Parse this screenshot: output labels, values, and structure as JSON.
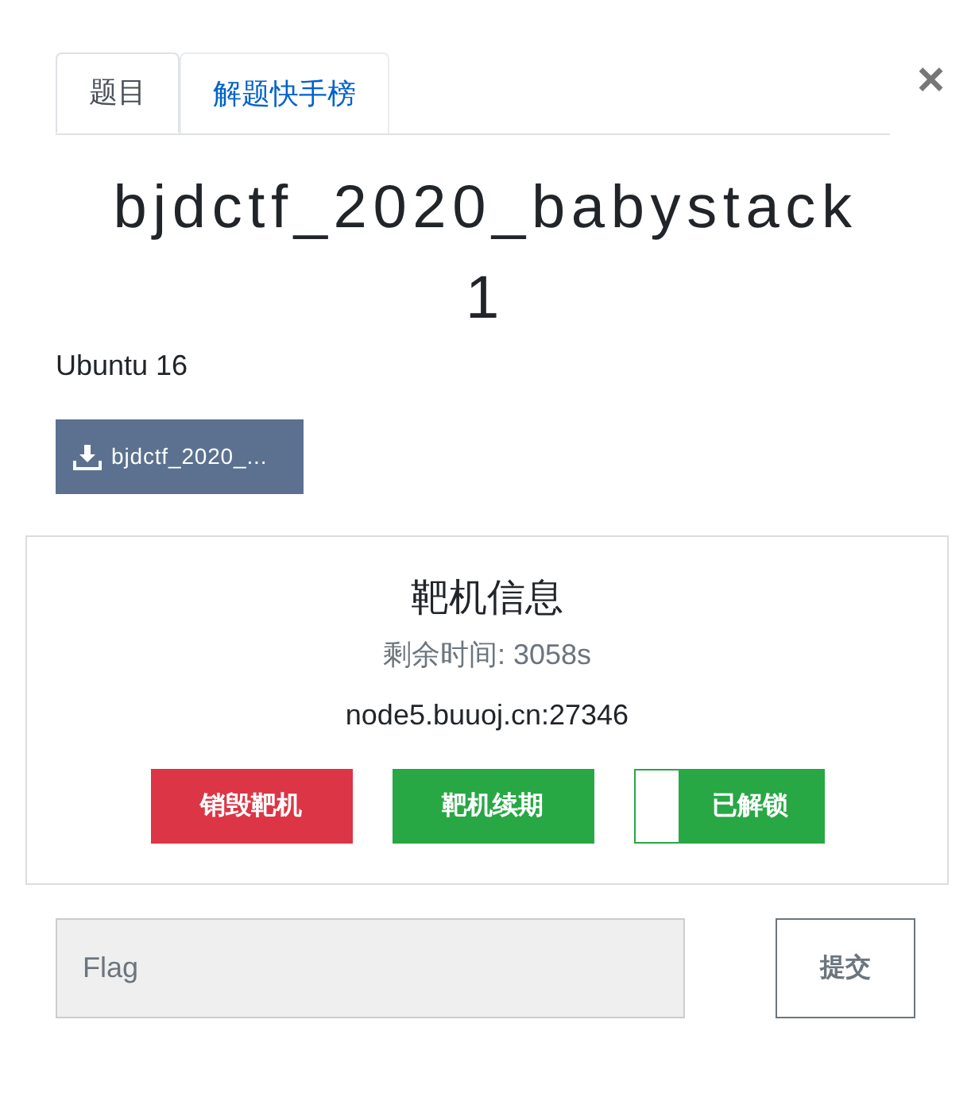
{
  "tabs": [
    {
      "label": "题目",
      "selected": true
    },
    {
      "label": "解题快手榜",
      "selected": false
    }
  ],
  "close_button": {
    "label": "×"
  },
  "challenge": {
    "title": "bjdctf_2020_babystack 1",
    "description": "Ubuntu 16",
    "download_button": {
      "label": "bjdctf_2020_..."
    }
  },
  "target_panel": {
    "title": "靶机信息",
    "remaining_time": "剩余时间: 3058s",
    "address": "node5.buuoj.cn:27346",
    "buttons": [
      {
        "kind": "destroy",
        "label": "销毁靶机"
      },
      {
        "kind": "renew",
        "label": "靶机续期"
      }
    ],
    "unlock_toggle": {
      "label": "已解锁",
      "on": true
    }
  },
  "flag_form": {
    "placeholder": "Flag",
    "submit_label": "提交"
  }
}
